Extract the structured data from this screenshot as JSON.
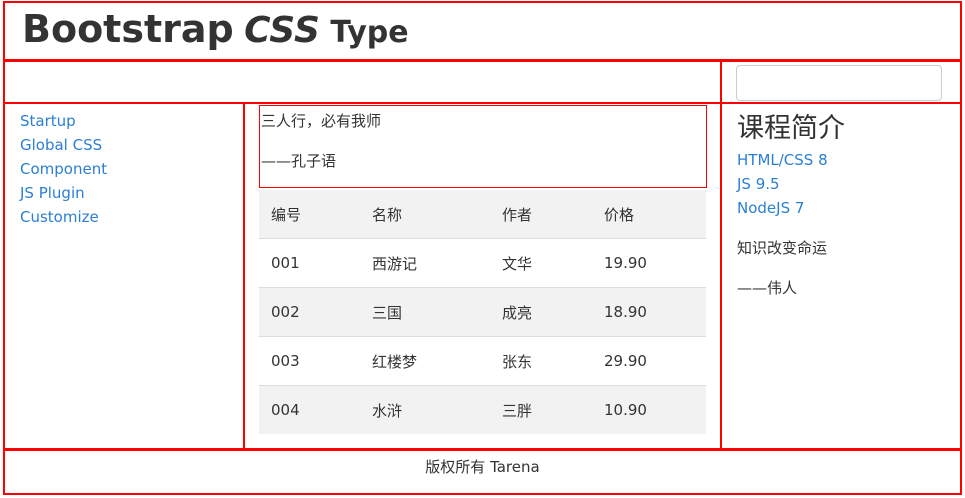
{
  "header": {
    "title_bold": "Bootstrap",
    "title_italic": "CSS",
    "title_small": "Type"
  },
  "sidebar": {
    "items": [
      {
        "label": "Startup"
      },
      {
        "label": "Global CSS"
      },
      {
        "label": "Component"
      },
      {
        "label": "JS Plugin"
      },
      {
        "label": "Customize"
      }
    ]
  },
  "main": {
    "quote_line1": "三人行，必有我师",
    "quote_line2": "——孔子语",
    "table": {
      "headers": [
        "编号",
        "名称",
        "作者",
        "价格"
      ],
      "rows": [
        [
          "001",
          "西游记",
          "文华",
          "19.90"
        ],
        [
          "002",
          "三国",
          "成亮",
          "18.90"
        ],
        [
          "003",
          "红楼梦",
          "张东",
          "29.90"
        ],
        [
          "004",
          "水浒",
          "三胖",
          "10.90"
        ]
      ]
    }
  },
  "aside": {
    "title": "课程简介",
    "courses": [
      {
        "label": "HTML/CSS 8"
      },
      {
        "label": "JS 9.5"
      },
      {
        "label": "NodeJS 7"
      }
    ],
    "para1": "知识改变命运",
    "para2": "——伟人"
  },
  "footer": {
    "text": "版权所有 Tarena"
  },
  "colors": {
    "border": "#ff0000",
    "link": "#2a7fd4",
    "stripe": "#f2f2f2"
  }
}
